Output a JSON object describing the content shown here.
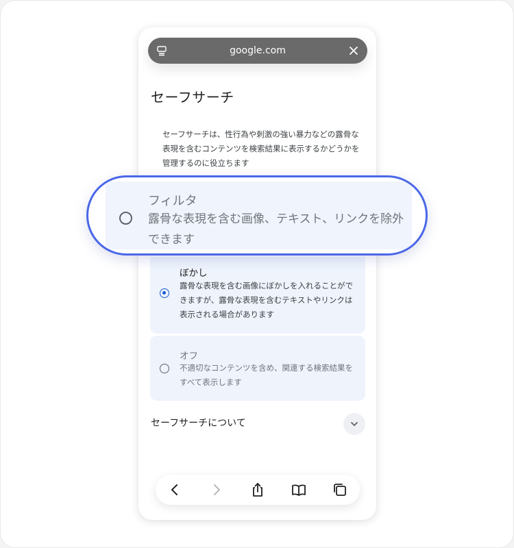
{
  "browser": {
    "url": "google.com",
    "tab_icon": "tab-overview-icon",
    "close_icon": "close-icon"
  },
  "page": {
    "title": "セーフサーチ",
    "description": "セーフサーチは、性行為や刺激の強い暴力などの露骨な表現を含むコンテンツを検索結果に表示するかどうかを管理するのに役立ちます"
  },
  "options": [
    {
      "id": "filter",
      "title": "フィルタ",
      "body": "露骨な表現を含む画像、テキスト、リンクを除外できます",
      "selected": false
    },
    {
      "id": "blur",
      "title": "ぼかし",
      "body": "露骨な表現を含む画像にぼかしを入れることができますが、露骨な表現を含むテキストやリンクは表示される場合があります",
      "selected": true
    },
    {
      "id": "off",
      "title": "オフ",
      "body": "不適切なコンテンツを含め、関連する検索結果をすべて表示します",
      "selected": false
    }
  ],
  "about": {
    "label": "セーフサーチについて",
    "icon": "chevron-down-icon"
  },
  "toolbar": {
    "buttons": [
      "back-icon",
      "forward-icon",
      "share-icon",
      "bookmarks-icon",
      "tabs-icon"
    ]
  },
  "colors": {
    "accent": "#4a67e8",
    "selected_radio": "#1a5fd2",
    "option_bg": "#eef3fc",
    "urlbar_bg": "#6a6a6a"
  }
}
